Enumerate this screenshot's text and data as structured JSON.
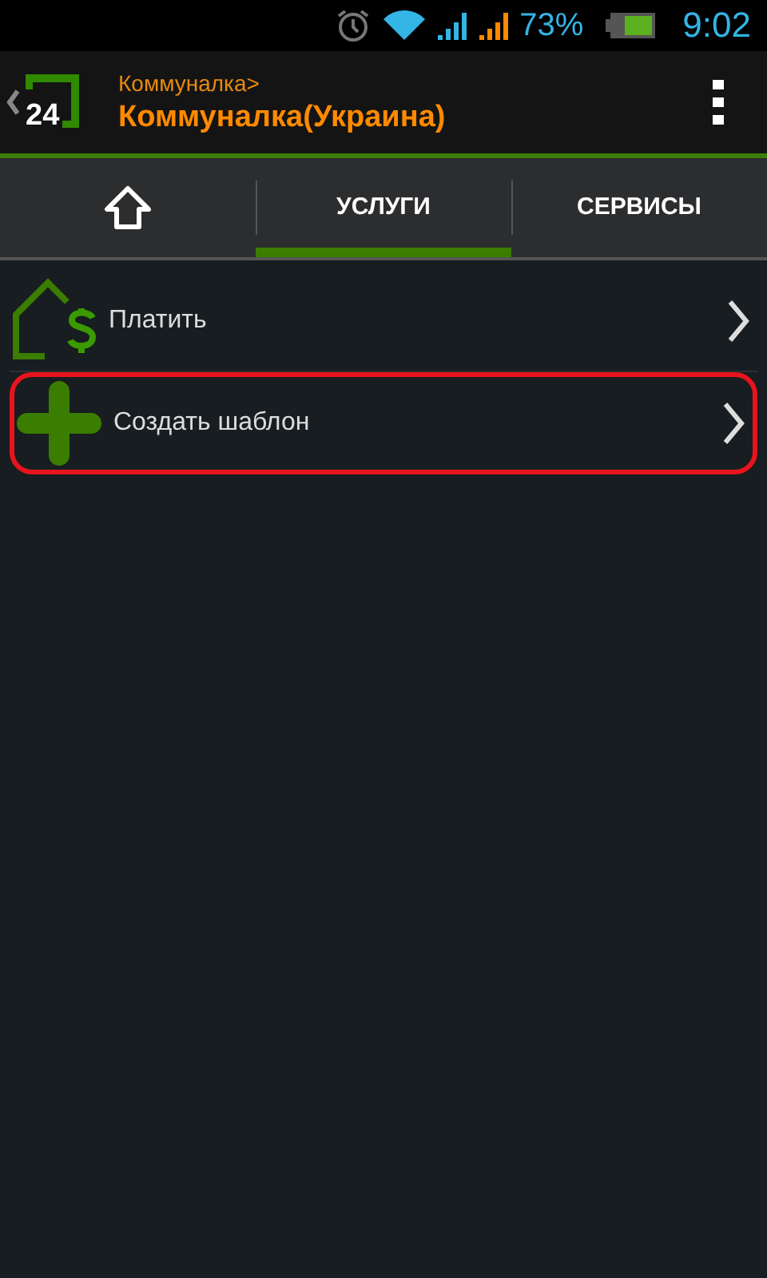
{
  "status_bar": {
    "battery_percent": "73%",
    "time": "9:02"
  },
  "action_bar": {
    "breadcrumb": "Коммуналка>",
    "title": "Коммуналка(Украина)",
    "logo_text": "24"
  },
  "tabs": [
    {
      "kind": "icon",
      "selected": false
    },
    {
      "kind": "text",
      "label": "УСЛУГИ",
      "selected": true
    },
    {
      "kind": "text",
      "label": "СЕРВИСЫ",
      "selected": false
    }
  ],
  "items": [
    {
      "kind": "pay",
      "label": "Платить",
      "highlighted": false
    },
    {
      "kind": "add",
      "label": "Создать шаблон",
      "highlighted": true
    }
  ]
}
